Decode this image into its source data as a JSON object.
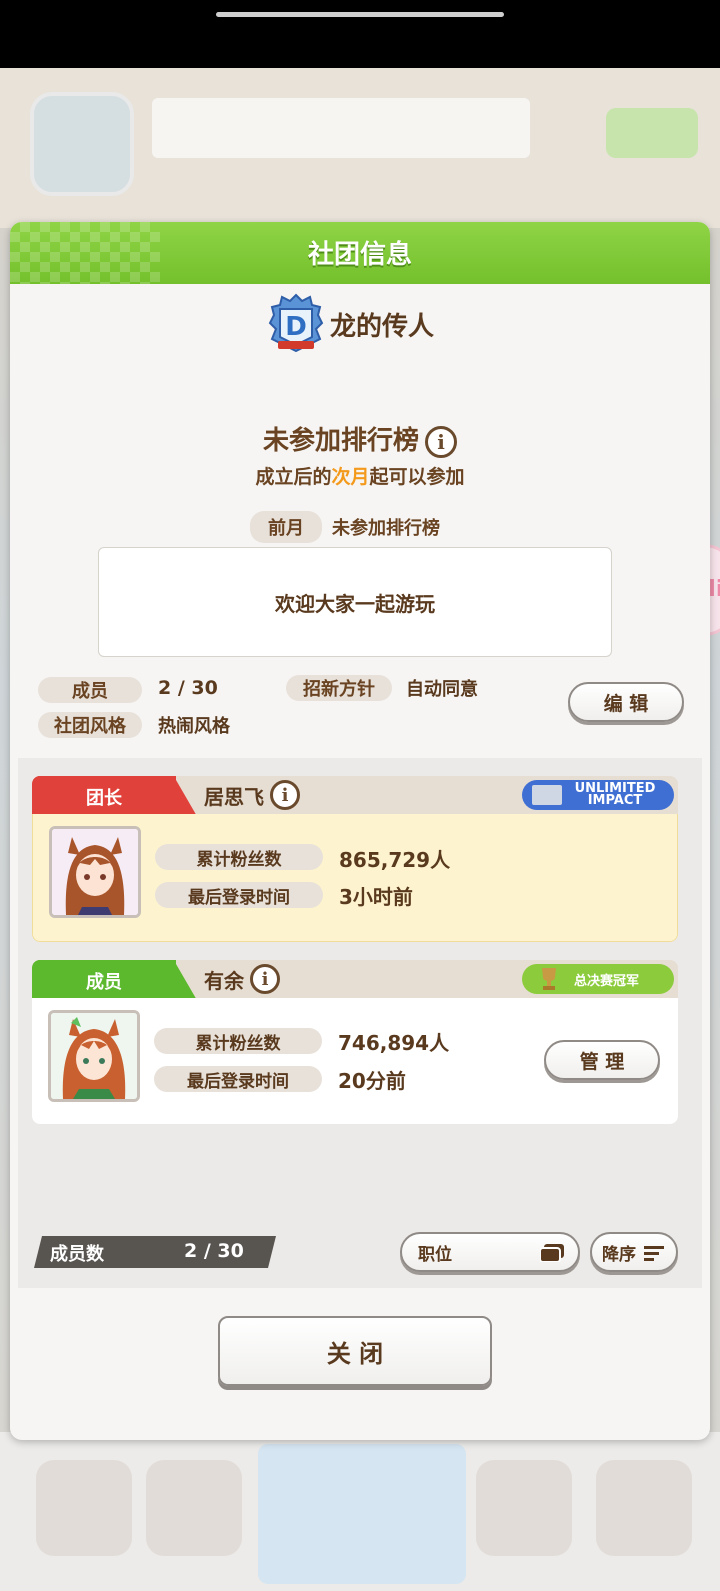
{
  "dialog": {
    "title": "社团信息"
  },
  "club": {
    "name": "龙的传人"
  },
  "ranking": {
    "status": "未参加排行榜",
    "note_prefix": "成立后的",
    "note_highlight": "次月",
    "note_suffix": "起可以参加",
    "prev_label": "前月",
    "prev_value": "未参加排行榜"
  },
  "welcome_message": "欢迎大家一起游玩",
  "stats": {
    "members_label": "成员",
    "members_value": "2 / 30",
    "recruit_label": "招新方针",
    "recruit_value": "自动同意",
    "style_label": "社团风格",
    "style_value": "热闹风格",
    "edit_button": "编 辑"
  },
  "members": [
    {
      "role": "团长",
      "role_color": "#e0413a",
      "name": "居思飞",
      "badge": "UNLIMITED IMPACT",
      "fans_label": "累计粉丝数",
      "fans_value": "865,729人",
      "login_label": "最后登录时间",
      "login_value": "3小时前"
    },
    {
      "role": "成员",
      "role_color": "#5cb82c",
      "name": "有余",
      "badge": "总决赛冠军",
      "fans_label": "累计粉丝数",
      "fans_value": "746,894人",
      "login_label": "最后登录时间",
      "login_value": "20分前",
      "manage_button": "管 理"
    }
  ],
  "footer": {
    "count_label": "成员数",
    "count_value": "2 / 30",
    "sort_field": "职位",
    "sort_order": "降序",
    "close_button": "关 闭"
  },
  "icons": [
    "info-icon",
    "club-emblem-icon",
    "list-view-icon",
    "sort-lines-icon",
    "trophy-icon"
  ]
}
